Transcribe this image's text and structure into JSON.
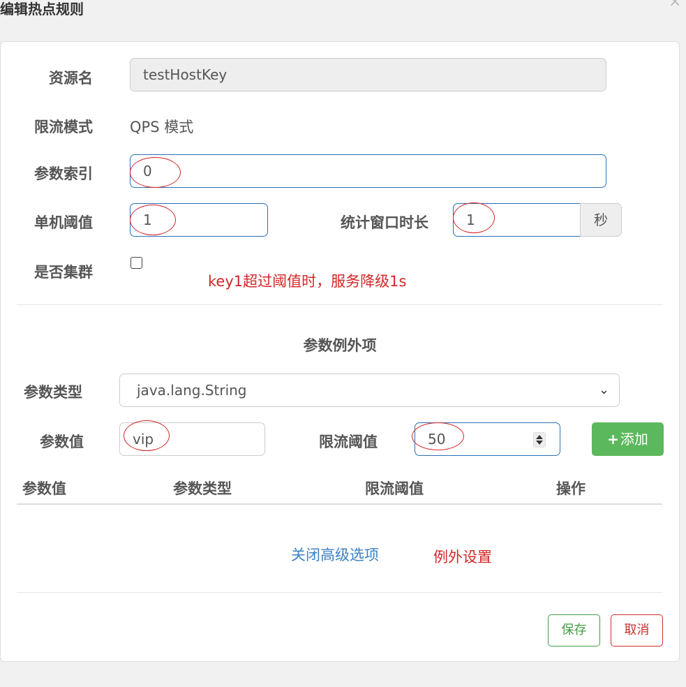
{
  "dialog": {
    "title": "编辑热点规则",
    "close_icon": "×"
  },
  "form": {
    "resource_label": "资源名",
    "resource_value": "testHostKey",
    "mode_label": "限流模式",
    "mode_value": "QPS 模式",
    "param_index_label": "参数索引",
    "param_index_value": "0",
    "threshold_label": "单机阈值",
    "threshold_value": "1",
    "window_label": "统计窗口时长",
    "window_value": "1",
    "window_unit": "秒",
    "cluster_label": "是否集群",
    "cluster_checked": false
  },
  "annotations": {
    "note_fallback": "key1超过阈值时，服务降级1s",
    "note_exception": "例外设置",
    "color": "#d42626"
  },
  "exceptions": {
    "section_title": "参数例外项",
    "type_label": "参数类型",
    "type_value": "java.lang.String",
    "value_label": "参数值",
    "value_value": "vip",
    "limit_label": "限流阈值",
    "limit_value": "50",
    "add_label": "添加",
    "add_icon": "+",
    "table_headers": [
      "参数值",
      "参数类型",
      "限流阈值",
      "操作"
    ],
    "toggle_link": "关闭高级选项"
  },
  "footer": {
    "save_label": "保存",
    "cancel_label": "取消"
  },
  "colors": {
    "primary_border": "#2a6fb6",
    "success": "#5cb85c",
    "danger": "#c9302c",
    "link": "#3b82c4"
  }
}
